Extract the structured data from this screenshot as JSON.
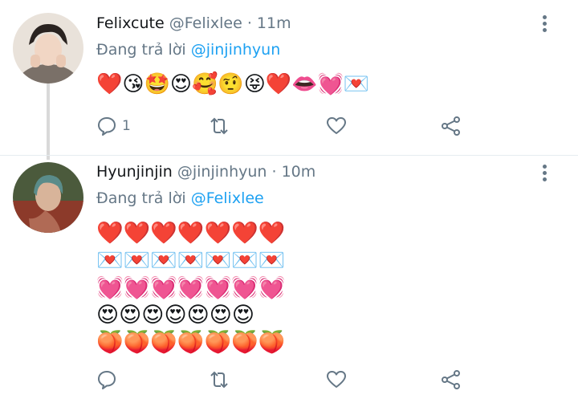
{
  "tweets": [
    {
      "name": "Felixcute",
      "handle": "@Felixlee",
      "dot": "·",
      "time": "11m",
      "reply_prefix": "Đang trả lời",
      "reply_to": "@jinjinhyun",
      "emoji_text": "❤️😘🤩😍🥰🤨😝❤️👄💓💌",
      "reply_count": "1",
      "avatar": "avatar-felixcute"
    },
    {
      "name": "Hyunjinjin",
      "handle": "@jinjinhyun",
      "dot": "·",
      "time": "10m",
      "reply_prefix": "Đang trả lời",
      "reply_to": "@Felixlee",
      "emoji_rows": [
        "❤️❤️❤️❤️❤️❤️❤️",
        "💌💌💌💌💌💌💌",
        "💓💓💓💓💓💓💓",
        "😍😍😍😍😍😍😍",
        "🍑🍑🍑🍑🍑🍑🍑"
      ],
      "reply_count": "",
      "avatar": "avatar-hyunjinjin"
    }
  ],
  "icons": {
    "reply": "reply-icon",
    "retweet": "retweet-icon",
    "like": "heart-icon",
    "share": "share-icon",
    "more": "more-vertical-icon"
  },
  "colors": {
    "link": "#1da1f2",
    "secondary_text": "#657786",
    "icon": "#657786",
    "thread_line": "#d9d9d9"
  }
}
